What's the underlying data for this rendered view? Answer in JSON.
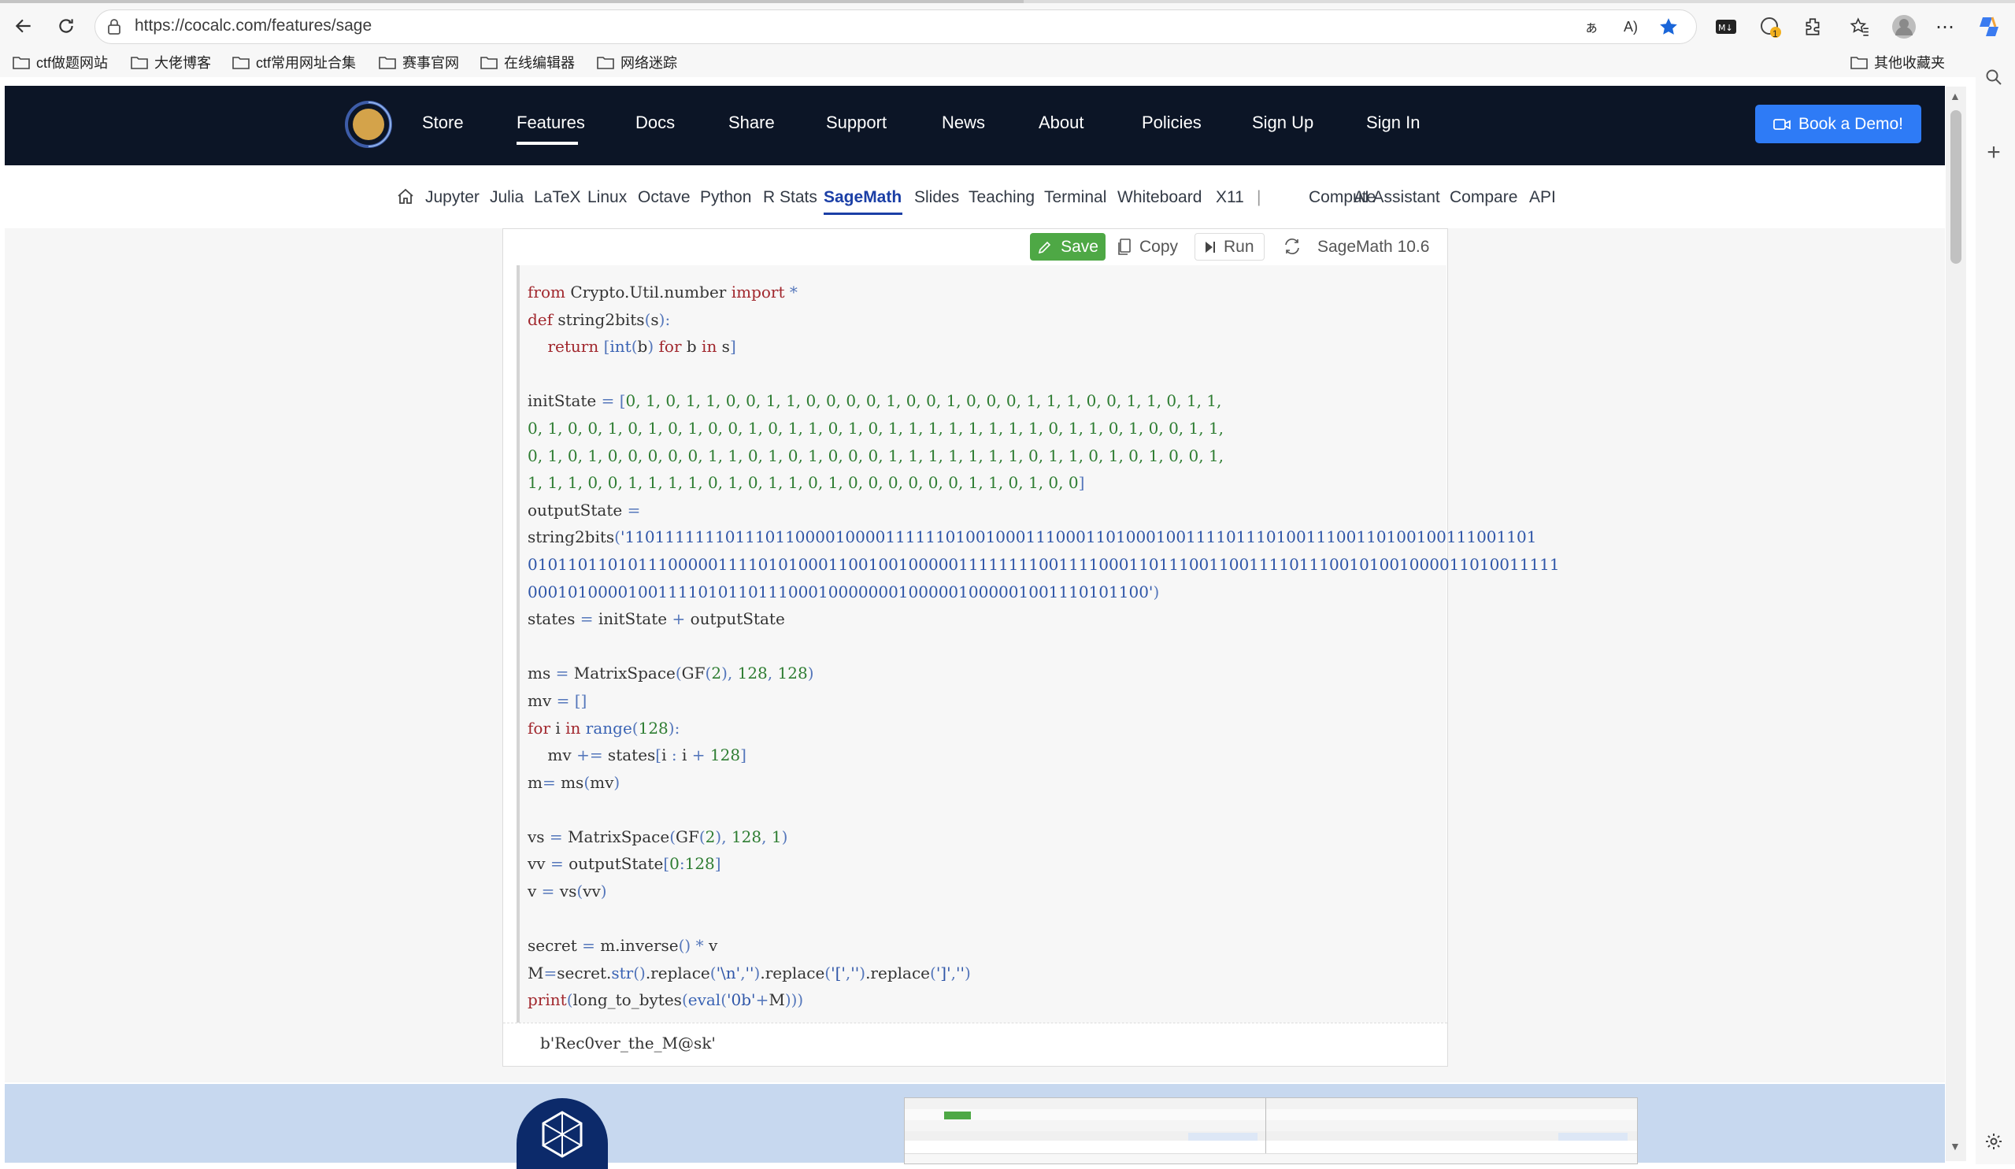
{
  "browser": {
    "url": "https://cocalc.com/features/sage",
    "bookmarks": [
      "ctf做题网站",
      "大佬博客",
      "ctf常用网址合集",
      "赛事官网",
      "在线编辑器",
      "网络迷踪"
    ],
    "other_bookmarks": "其他收藏夹",
    "badge_count": "1"
  },
  "header": {
    "nav": [
      "Store",
      "Features",
      "Docs",
      "Share",
      "Support",
      "News",
      "About",
      "Policies",
      "Sign Up",
      "Sign In"
    ],
    "active_nav": "Features",
    "demo_button": "Book a Demo!"
  },
  "subnav": {
    "items": [
      "Jupyter",
      "Julia",
      "LaTeX",
      "Linux",
      "Octave",
      "Python",
      "R Stats",
      "SageMath",
      "Slides",
      "Teaching",
      "Terminal",
      "Whiteboard",
      "X11"
    ],
    "separator": "|",
    "extra": [
      "Compute",
      "AI Assistant",
      "Compare",
      "API"
    ],
    "active": "SageMath"
  },
  "editor": {
    "save": "Save",
    "copy": "Copy",
    "run": "Run",
    "kernel": "SageMath 10.6",
    "output": "b'Rec0ver_the_M@sk'"
  },
  "code_lines": [
    "from Crypto.Util.number import *",
    "def string2bits(s):",
    "    return [int(b) for b in s]",
    "",
    "initState = [0, 1, 0, 1, 1, 0, 0, 1, 1, 0, 0, 0, 0, 1, 0, 0, 1, 0, 0, 0, 1, 1, 1, 0, 0, 1, 1, 0, 1, 1,",
    "0, 1, 0, 0, 1, 0, 1, 0, 1, 0, 0, 1, 0, 1, 1, 0, 1, 0, 1, 1, 1, 1, 1, 1, 1, 1, 0, 1, 1, 0, 1, 0, 0, 1, 1,",
    "0, 1, 0, 1, 0, 0, 0, 0, 0, 1, 1, 0, 1, 0, 1, 0, 0, 0, 1, 1, 1, 1, 1, 1, 1, 0, 1, 1, 0, 1, 0, 1, 0, 0, 1,",
    "1, 1, 1, 0, 0, 1, 1, 1, 1, 0, 1, 0, 1, 1, 0, 1, 0, 0, 0, 0, 0, 0, 1, 1, 0, 1, 0, 0]",
    "outputState =",
    "string2bits('1101111111011101100001000011111101001000111000110100010011110111010011100110100100111001101",
    "0101101101011100000111101010001100100100000111111110011110001101110011001111011100101001000011010011111",
    "000101000010011110101101110001000000010000010000010011101011​0')",
    "states = initState + outputState",
    "",
    "ms = MatrixSpace(GF(2), 128, 128)",
    "mv = []",
    "for i in range(128):",
    "    mv += states[i : i + 128]",
    "m= ms(mv)",
    "",
    "vs = MatrixSpace(GF(2), 128, 1)",
    "vv = outputState[0:128]",
    "v = vs(vv)",
    "",
    "secret = m.inverse() * v",
    "M=secret.str().replace('\\n','').replace('[','').replace(']','')",
    "print(long_to_bytes(eval('0b'+M)))"
  ],
  "colors": {
    "header_bg": "#0c1526",
    "accent": "#2e7bf6",
    "save_green": "#4ea845",
    "active_sub": "#1b3fa6"
  }
}
